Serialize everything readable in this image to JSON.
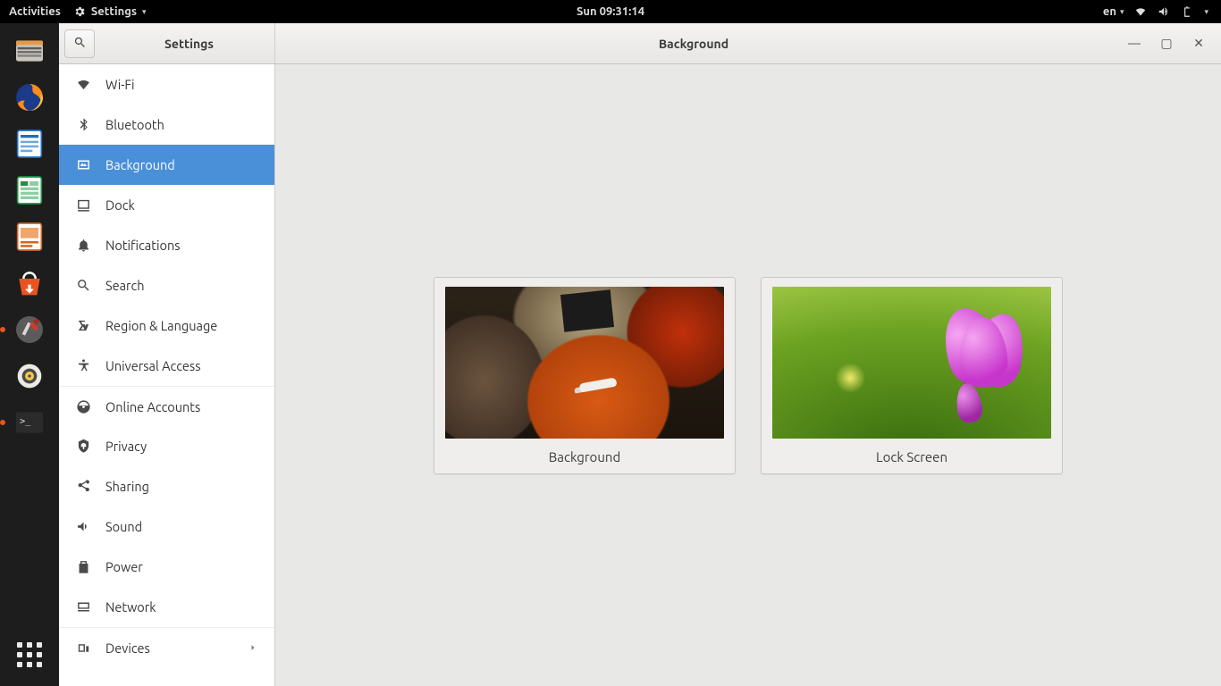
{
  "topbar": {
    "activities": "Activities",
    "appmenu": "Settings",
    "clock": "Sun 09:31:14",
    "lang": "en"
  },
  "window": {
    "left_title": "Settings",
    "right_title": "Background",
    "controls": {
      "min": "—",
      "max": "▢",
      "close": "✕"
    }
  },
  "sidebar": {
    "items": [
      {
        "id": "wifi",
        "label": "Wi-Fi"
      },
      {
        "id": "bluetooth",
        "label": "Bluetooth"
      },
      {
        "id": "background",
        "label": "Background",
        "active": true
      },
      {
        "id": "dock",
        "label": "Dock"
      },
      {
        "id": "notifications",
        "label": "Notifications"
      },
      {
        "id": "search",
        "label": "Search"
      },
      {
        "id": "region",
        "label": "Region & Language"
      },
      {
        "id": "universal",
        "label": "Universal Access"
      },
      {
        "id": "online",
        "label": "Online Accounts",
        "sep": true
      },
      {
        "id": "privacy",
        "label": "Privacy"
      },
      {
        "id": "sharing",
        "label": "Sharing"
      },
      {
        "id": "sound",
        "label": "Sound"
      },
      {
        "id": "power",
        "label": "Power"
      },
      {
        "id": "network",
        "label": "Network"
      },
      {
        "id": "devices",
        "label": "Devices",
        "sep": true,
        "arrow": true
      }
    ]
  },
  "content": {
    "background_label": "Background",
    "lockscreen_label": "Lock Screen"
  }
}
